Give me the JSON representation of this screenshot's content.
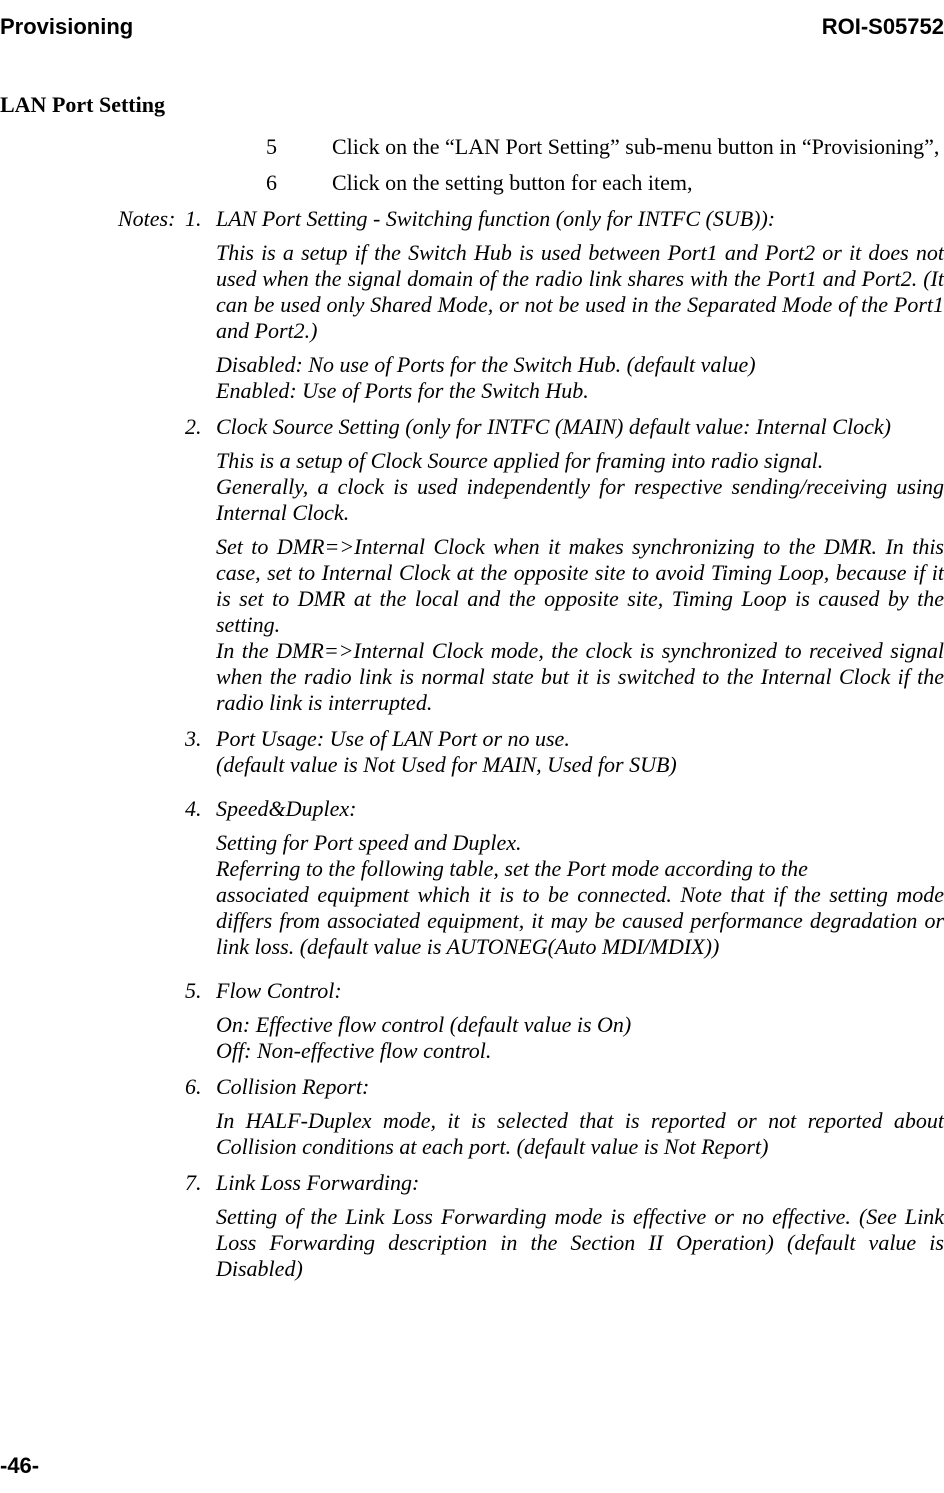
{
  "header": {
    "left": "Provisioning",
    "right": "ROI-S05752"
  },
  "section_heading": "LAN Port Setting",
  "steps": [
    {
      "num": "5",
      "text": "Click on the “LAN Port Setting” sub-menu button in “Provisioning”,"
    },
    {
      "num": "6",
      "text": "Click on the setting button for each item,"
    }
  ],
  "notes_label": "Notes:",
  "notes": [
    {
      "num": "1.",
      "title": " LAN Port Setting - Switching function (only for INTFC (SUB)):",
      "paras": [
        "This is a setup if the Switch Hub is used between Port1 and Port2 or it does not used when the signal domain of the radio link shares with the Port1 and Port2. (It can be used only Shared Mode, or not be used in the Separated Mode of the Port1 and Port2.)",
        "Disabled:   No use of Ports for the Switch Hub. (default value)\nEnabled:    Use of Ports for the Switch Hub."
      ]
    },
    {
      "num": "2.",
      "title": "Clock Source Setting (only for INTFC (MAIN) default value: Internal Clock)",
      "paras": [
        "This is a setup of Clock Source applied for framing into radio signal.\nGenerally, a clock is used independently for respective sending/receiving using Internal Clock.",
        "Set to DMR=>Internal Clock when it makes synchronizing to the DMR.  In this case, set to Internal Clock at the opposite site to avoid Timing Loop, because if it is set to DMR at the local and the opposite site, Timing Loop is caused by the setting.\nIn the DMR=>Internal Clock mode, the clock is synchronized to received signal when the radio link is normal state but it is switched to the Internal Clock if the radio link is interrupted."
      ]
    },
    {
      "num": "3.",
      "title": "Port Usage: Use of LAN Port or no use.\n(default value is Not Used for MAIN, Used for SUB)",
      "paras": []
    },
    {
      "num": "4.",
      "title": "Speed&Duplex:",
      "paras": [
        "Setting for Port speed and Duplex.\nReferring to the following table, set the Port mode according to the\nassociated equipment which it is to be connected.  Note that if the setting mode differs from associated equipment, it may be caused performance degradation or link loss. (default value is AUTONEG(Auto MDI/MDIX))"
      ]
    },
    {
      "num": "5.",
      "title": "Flow Control:",
      "paras": [
        "On: Effective flow control (default value is On)\nOff: Non-effective flow control."
      ]
    },
    {
      "num": "6.",
      "title": "Collision Report:",
      "paras": [
        "In HALF-Duplex mode, it is selected that is reported or not reported about Collision conditions at each port. (default value is Not Report)"
      ]
    },
    {
      "num": "7.",
      "title": "Link Loss Forwarding:",
      "paras": [
        "Setting of the Link Loss Forwarding mode is effective or no effective. (See Link Loss Forwarding description in the Section II Operation) (default value is Disabled)"
      ]
    }
  ],
  "footer": "-46-"
}
